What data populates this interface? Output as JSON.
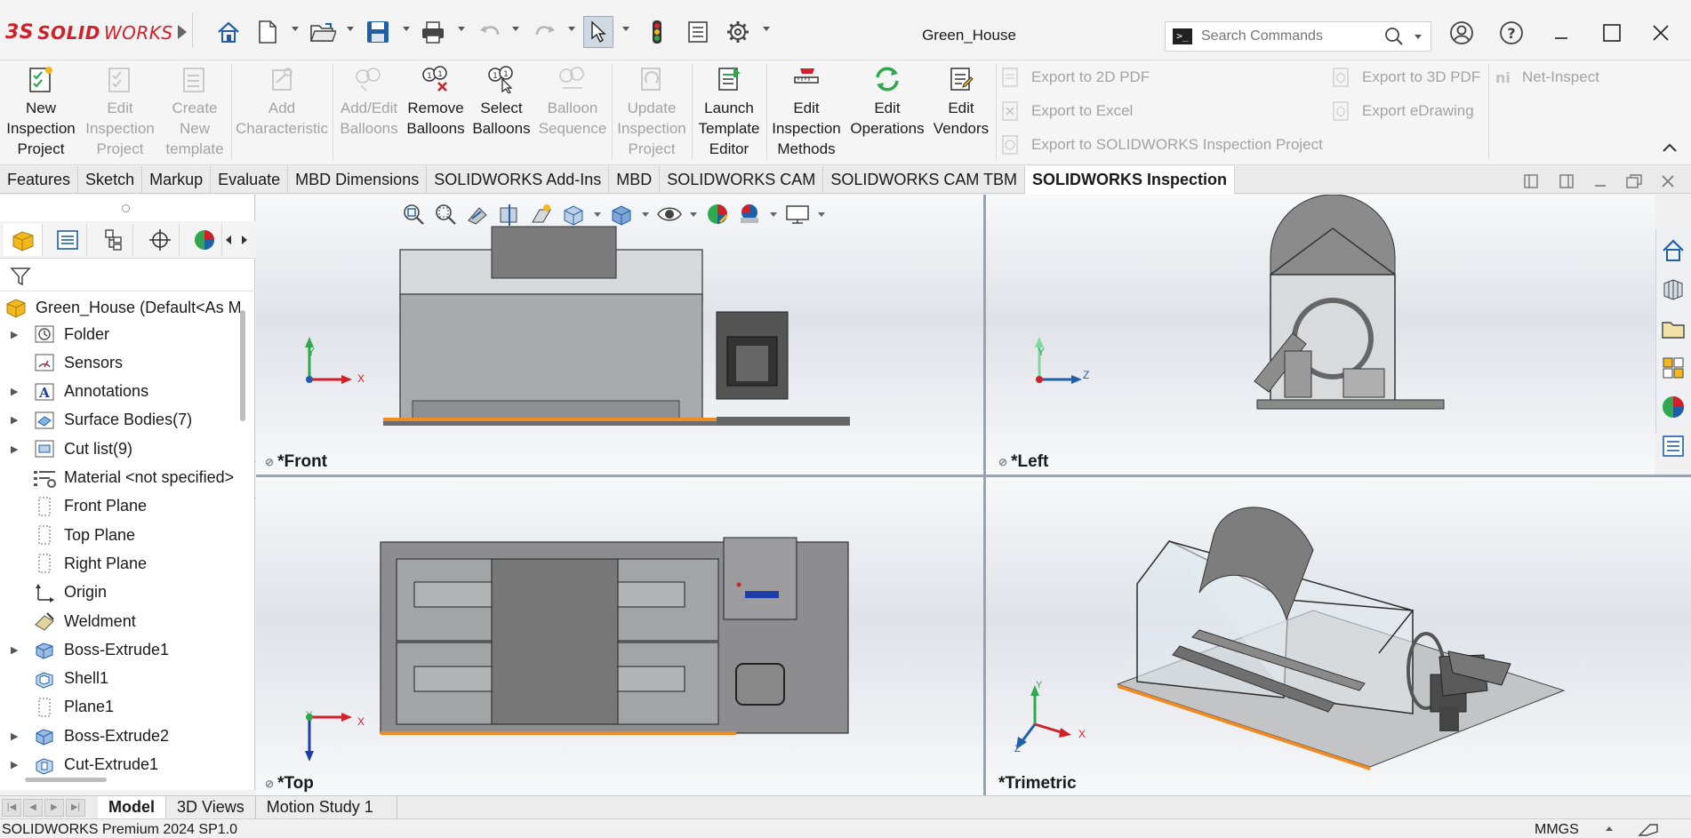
{
  "app": {
    "brand_prefix": "3S",
    "brand_bold": "SOLID",
    "brand_rest": "WORKS",
    "document_title": "Green_House"
  },
  "search": {
    "placeholder": "Search Commands"
  },
  "ribbon": {
    "large_buttons": [
      {
        "label1": "New",
        "label2": "Inspection",
        "label3": "Project",
        "enabled": true
      },
      {
        "label1": "Edit",
        "label2": "Inspection",
        "label3": "Project",
        "enabled": false
      },
      {
        "label1": "Create",
        "label2": "New",
        "label3": "template",
        "enabled": false
      },
      {
        "label1": "Add",
        "label2": "Characteristic",
        "enabled": false
      },
      {
        "label1": "Add/Edit",
        "label2": "Balloons",
        "enabled": false
      },
      {
        "label1": "Remove",
        "label2": "Balloons",
        "enabled": true
      },
      {
        "label1": "Select",
        "label2": "Balloons",
        "enabled": true
      },
      {
        "label1": "Balloon",
        "label2": "Sequence",
        "enabled": false
      },
      {
        "label1": "Update",
        "label2": "Inspection",
        "label3": "Project",
        "enabled": false
      },
      {
        "label1": "Launch",
        "label2": "Template",
        "label3": "Editor",
        "enabled": true
      },
      {
        "label1": "Edit",
        "label2": "Inspection",
        "label3": "Methods",
        "enabled": true
      },
      {
        "label1": "Edit",
        "label2": "Operations",
        "enabled": true
      },
      {
        "label1": "Edit",
        "label2": "Vendors",
        "enabled": true
      }
    ],
    "export_2d_pdf": "Export to 2D PDF",
    "export_excel": "Export to Excel",
    "export_sw_project": "Export to SOLIDWORKS Inspection Project",
    "export_3d_pdf": "Export to 3D PDF",
    "export_edrawing": "Export eDrawing",
    "net_inspect": "Net-Inspect"
  },
  "tabs": [
    "Features",
    "Sketch",
    "Markup",
    "Evaluate",
    "MBD Dimensions",
    "SOLIDWORKS Add-Ins",
    "MBD",
    "SOLIDWORKS CAM",
    "SOLIDWORKS CAM TBM",
    "SOLIDWORKS Inspection"
  ],
  "active_tab": "SOLIDWORKS Inspection",
  "tree": {
    "root": "Green_House  (Default<As M",
    "items": [
      {
        "label": "Folder",
        "expandable": true,
        "icon": "folder-icon"
      },
      {
        "label": "Sensors",
        "expandable": false,
        "icon": "sensors-icon"
      },
      {
        "label": "Annotations",
        "expandable": true,
        "icon": "annotations-icon"
      },
      {
        "label": "Surface Bodies(7)",
        "expandable": true,
        "icon": "surface-bodies-icon"
      },
      {
        "label": "Cut list(9)",
        "expandable": true,
        "icon": "cut-list-icon"
      },
      {
        "label": "Material <not specified>",
        "expandable": false,
        "icon": "material-icon"
      },
      {
        "label": "Front Plane",
        "expandable": false,
        "icon": "plane-icon"
      },
      {
        "label": "Top Plane",
        "expandable": false,
        "icon": "plane-icon"
      },
      {
        "label": "Right Plane",
        "expandable": false,
        "icon": "plane-icon"
      },
      {
        "label": "Origin",
        "expandable": false,
        "icon": "origin-icon"
      },
      {
        "label": "Weldment",
        "expandable": false,
        "icon": "weldment-icon"
      },
      {
        "label": "Boss-Extrude1",
        "expandable": true,
        "icon": "extrude-icon"
      },
      {
        "label": "Shell1",
        "expandable": false,
        "icon": "shell-icon"
      },
      {
        "label": "Plane1",
        "expandable": false,
        "icon": "plane-icon"
      },
      {
        "label": "Boss-Extrude2",
        "expandable": true,
        "icon": "extrude-icon"
      },
      {
        "label": "Cut-Extrude1",
        "expandable": true,
        "icon": "cut-extrude-icon"
      }
    ]
  },
  "viewports": {
    "front": "*Front",
    "left": "*Left",
    "top": "*Top",
    "trimetric": "*Trimetric"
  },
  "axes": {
    "x": "X",
    "y": "Y",
    "z": "Z"
  },
  "bottom_tabs": [
    "Model",
    "3D Views",
    "Motion Study 1"
  ],
  "active_bottom_tab": "Model",
  "status": {
    "left": "SOLIDWORKS Premium 2024 SP1.0",
    "units": "MMGS"
  },
  "colors": {
    "brand_red": "#d0202a",
    "accent_orange": "#f08a24",
    "model_gray": "#8a8a8a"
  }
}
